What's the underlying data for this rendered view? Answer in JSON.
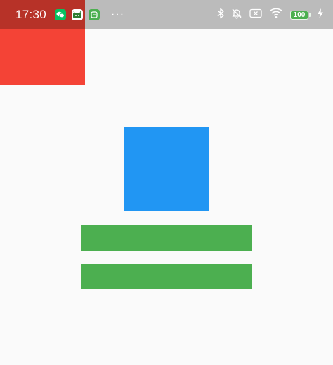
{
  "status_bar": {
    "time": "17:30",
    "notifications": [
      {
        "icon": "wechat-icon",
        "color": "#07C160"
      },
      {
        "icon": "android-app-icon",
        "color": "#3DDC84"
      },
      {
        "icon": "green-app-icon",
        "color": "#4CAF50"
      }
    ],
    "more": "···",
    "system_icons": [
      "bluetooth-icon",
      "mute-bell-icon",
      "sim-none-icon",
      "wifi-icon"
    ],
    "battery_level": "100",
    "charging": true
  },
  "colors": {
    "red": "#F44336",
    "blue": "#2196F3",
    "green": "#4CAF50",
    "background": "#FAFAFA"
  }
}
